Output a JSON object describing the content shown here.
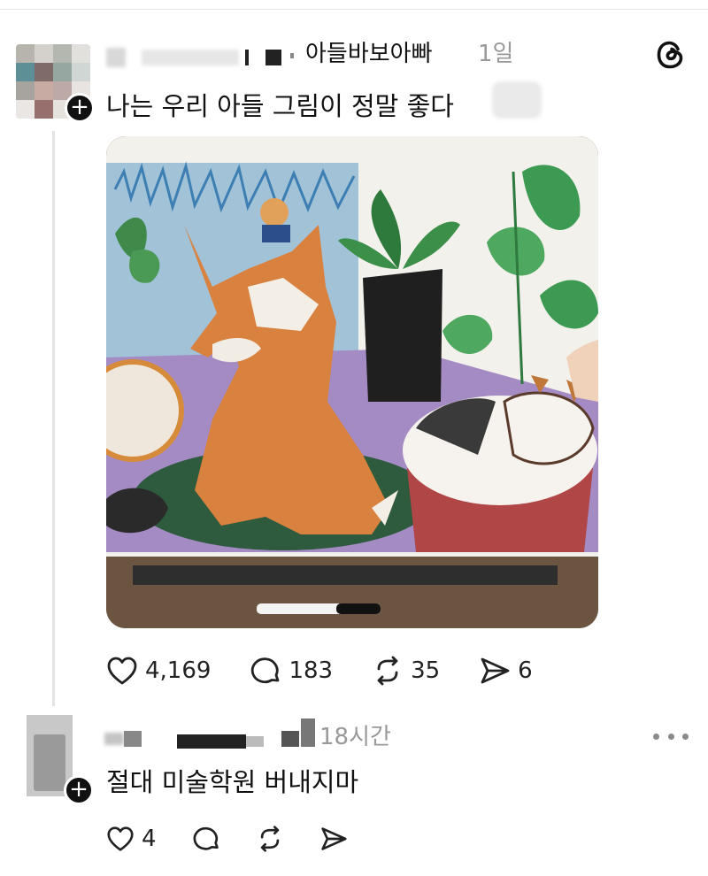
{
  "post": {
    "username": "아들바보아빠",
    "time": "1일",
    "text": "나는 우리 아들 그림이 정말 좋다",
    "image_alt": "child's crayon drawing of a fox, a cat in a basket and potted plants",
    "likes": "4,169",
    "comments": "183",
    "reposts": "35",
    "shares": "6"
  },
  "reply": {
    "time": "18시간",
    "text": "절대 미술학원 버내지마",
    "likes": "4"
  },
  "icons": {
    "threads_logo": "threads-logo-icon",
    "follow": "plus-icon",
    "like": "heart-icon",
    "comment": "comment-bubble-icon",
    "repost": "repost-arrows-icon",
    "share": "send-icon",
    "more": "more-dots-icon"
  },
  "colors": {
    "text": "#111111",
    "muted": "#999999",
    "thread_line": "#e3e3e3"
  }
}
